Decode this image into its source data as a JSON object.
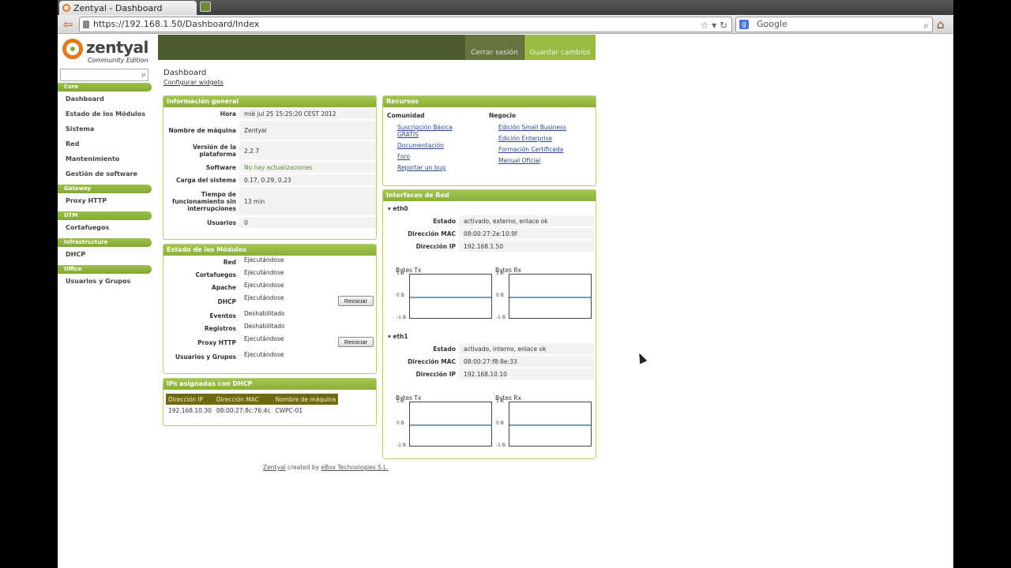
{
  "browser": {
    "tab_title": "Zentyal - Dashboard",
    "url": "https://192.168.1.50/Dashboard/Index",
    "search_placeholder": "Google"
  },
  "header": {
    "logo_text": "zentyal",
    "logo_subtitle": "Community Edition",
    "logout_label": "Cerrar sesión",
    "save_label": "Guardar cambios"
  },
  "sidebar": {
    "sections": [
      {
        "title": "Core",
        "items": [
          "Dashboard",
          "Estado de los Módulos",
          "Sistema",
          "Red",
          "Mantenimiento",
          "Gestión de software"
        ]
      },
      {
        "title": "Gateway",
        "items": [
          "Proxy HTTP"
        ]
      },
      {
        "title": "UTM",
        "items": [
          "Cortafuegos"
        ]
      },
      {
        "title": "Infrastructure",
        "items": [
          "DHCP"
        ]
      },
      {
        "title": "Office",
        "items": [
          "Usuarios y Grupos"
        ]
      }
    ]
  },
  "main": {
    "title": "Dashboard",
    "configure_link": "Configurar widgets"
  },
  "general": {
    "title": "Información general",
    "rows": [
      {
        "k": "Hora",
        "v": "mié jul 25 15:25:20 CEST 2012"
      },
      {
        "k": "Nombre de máquina",
        "v": "Zentyal"
      },
      {
        "k": "Versión de la plataforma",
        "v": "2.2.7"
      },
      {
        "k": "Software",
        "v": "No hay actualizaciones"
      },
      {
        "k": "Carga del sistema",
        "v": "0.17, 0.29, 0.23"
      },
      {
        "k": "Tiempo de funcionamiento sin interrupciones",
        "v": "13 min"
      },
      {
        "k": "Usuarios",
        "v": "0"
      }
    ]
  },
  "modules": {
    "title": "Estado de los Módulos",
    "restart_label": "Reiniciar",
    "rows": [
      {
        "k": "Red",
        "v": "Ejecutándose",
        "restart": false
      },
      {
        "k": "Cortafuegos",
        "v": "Ejecutándose",
        "restart": false
      },
      {
        "k": "Apache",
        "v": "Ejecutándose",
        "restart": false
      },
      {
        "k": "DHCP",
        "v": "Ejecutándose",
        "restart": true
      },
      {
        "k": "Eventos",
        "v": "Deshabilitado",
        "restart": false
      },
      {
        "k": "Registros",
        "v": "Deshabilitado",
        "restart": false
      },
      {
        "k": "Proxy HTTP",
        "v": "Ejecutándose",
        "restart": true
      },
      {
        "k": "Usuarios y Grupos",
        "v": "Ejecutándose",
        "restart": false
      }
    ]
  },
  "dhcp": {
    "title": "IPs asignadas con DHCP",
    "headers": [
      "Dirección IP",
      "Dirección MAC",
      "Nombre de máquina"
    ],
    "rows": [
      [
        "192.168.10.30",
        "08:00:27:8c:76:4c",
        "CWPC-01"
      ]
    ]
  },
  "resources": {
    "title": "Recursos",
    "community_title": "Comunidad",
    "community_links": [
      "Suscripción Básica GRATIS",
      "Documentación",
      "Foro",
      "Reportar un bug"
    ],
    "business_title": "Negocio",
    "business_links": [
      "Edición Small Business",
      "Edición Enterprise",
      "Formación Certificada",
      "Manual Oficial"
    ]
  },
  "interfaces": {
    "title": "Interfaces de Red",
    "graph_tx": "Bytes Tx",
    "graph_rx": "Bytes Rx",
    "axis": [
      "1 B",
      "0 B",
      "-1 B"
    ],
    "items": [
      {
        "name": "eth0",
        "rows": [
          {
            "k": "Estado",
            "v": "activado, externo, enlace ok"
          },
          {
            "k": "Dirección MAC",
            "v": "08:00:27:2e:10:9f"
          },
          {
            "k": "Dirección IP",
            "v": "192.168.1.50"
          }
        ]
      },
      {
        "name": "eth1",
        "rows": [
          {
            "k": "Estado",
            "v": "activado, interno, enlace ok"
          },
          {
            "k": "Dirección MAC",
            "v": "08:00:27:f8:8e:33"
          },
          {
            "k": "Dirección IP",
            "v": "192.168.10.10"
          }
        ]
      }
    ]
  },
  "footer": {
    "brand": "Zentyal",
    "created_by": "created by",
    "company": "eBox Technologies S.L."
  }
}
